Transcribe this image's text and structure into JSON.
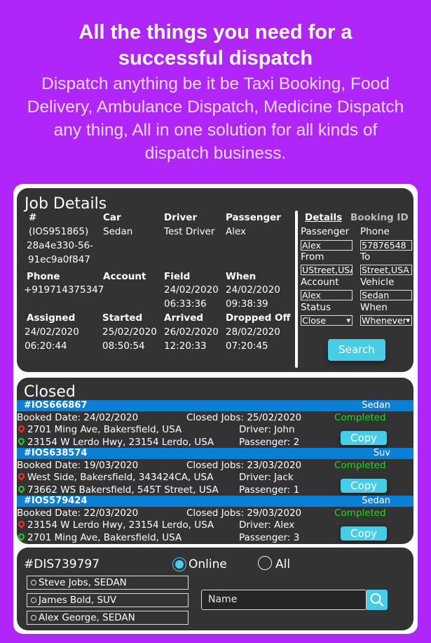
{
  "hero": {
    "title": "All the things you need for  a\nsuccessful  dispatch",
    "subtitle": "Dispatch anything be it be Taxi Booking, Food\nDelivery, Ambulance Dispatch, Medicine Dispatch\nany thing, All in one solution for all kinds of\ndispatch business."
  },
  "job_details": {
    "title": "Job Details",
    "row1": {
      "labels": [
        "#",
        "Car",
        "Driver",
        "Passenger"
      ],
      "id_lines": [
        "(IOS951865)",
        "28a4e330-56-",
        "91ec9a0f847"
      ],
      "car": "Sedan",
      "driver": "Test Driver",
      "passenger": "Alex"
    },
    "row2": {
      "labels": [
        "Phone",
        "Account",
        "Field",
        "When"
      ],
      "phone": "+919714375347",
      "account": "",
      "field": [
        "24/02/2020",
        "06:33:36"
      ],
      "when": [
        "24/02/2020",
        "09:38:39"
      ]
    },
    "row3": {
      "labels": [
        "Assigned",
        "Started",
        "Arrived",
        "Dropped Off"
      ],
      "assigned": [
        "24/02/2020",
        "06:20:44"
      ],
      "started": [
        "25/02/2020",
        "08:50:54"
      ],
      "arrived": [
        "26/02/2020",
        "12:20:33"
      ],
      "dropped_off": [
        "28/02/2020",
        "07:20:45"
      ]
    },
    "search_form": {
      "tabs": [
        {
          "label": "Details",
          "active": true
        },
        {
          "label": "Booking ID",
          "active": false
        }
      ],
      "fields": {
        "passenger": {
          "label": "Passenger",
          "value": "Alex"
        },
        "phone": {
          "label": "Phone",
          "value": "57876548"
        },
        "from": {
          "label": "From",
          "value": "UStreet,USA"
        },
        "to": {
          "label": "To",
          "value": "Street,USA"
        },
        "account": {
          "label": "Account",
          "value": "Alex"
        },
        "vehicle": {
          "label": "Vehicle",
          "value": "Sedan"
        },
        "status": {
          "label": "Status",
          "value": "Close"
        },
        "when": {
          "label": "When",
          "value": "Whenever"
        }
      },
      "search_button": "Search"
    }
  },
  "closed": {
    "title": "Closed",
    "jobs": [
      {
        "id": "#IOS666867",
        "car": "Sedan",
        "booked": "Booked Date: 24/02/2020",
        "closed": "Closed Jobs: 25/02/2020",
        "status": "Completed",
        "pickup": "2701 Ming Ave, Bakersfield, USA",
        "dropoff": "23154 W Lerdo Hwy, 23154 Lerdo, USA",
        "driver": "Driver: John",
        "passenger": "Passenger: 2",
        "copy": "Copy"
      },
      {
        "id": "#IOS638574",
        "car": "Suv",
        "booked": "Booked Date: 19/03/2020",
        "closed": "Closed Jobs: 23/03/2020",
        "status": "Completed",
        "pickup": "West Side, Bakersfield, 343424CA, USA",
        "dropoff": "73662 WS Bakersfield, 545T Street, USA",
        "driver": "Driver: Jack",
        "passenger": "Passenger: 1",
        "copy": "Copy"
      },
      {
        "id": "#IOS579424",
        "car": "Sedan",
        "booked": "Booked Date: 22/03/2020",
        "closed": "Closed Jobs: 29/03/2020",
        "status": "Completed",
        "pickup": "23154 W Lerdo Hwy, 23154 Lerdo, USA",
        "dropoff": "2701 Ming Ave, Bakersfield, USA",
        "driver": "Driver: Alex",
        "passenger": "Passenger: 3",
        "copy": "Copy"
      }
    ]
  },
  "dispatch": {
    "id": "#DIS739797",
    "filters": [
      {
        "label": "Online",
        "selected": true
      },
      {
        "label": "All",
        "selected": false
      }
    ],
    "drivers": [
      "Steve Jobs, SEDAN",
      "James Bold, SUV",
      "Alex George, SEDAN"
    ],
    "search_placeholder": "Name"
  },
  "colors": {
    "background": "#b026f8",
    "panel": "#333333",
    "accent": "#48cde8",
    "job_bar": "#0a7fd6",
    "completed": "#29d129",
    "pickup_pin": "#ff2f2f",
    "dropoff_pin": "#29d129"
  }
}
